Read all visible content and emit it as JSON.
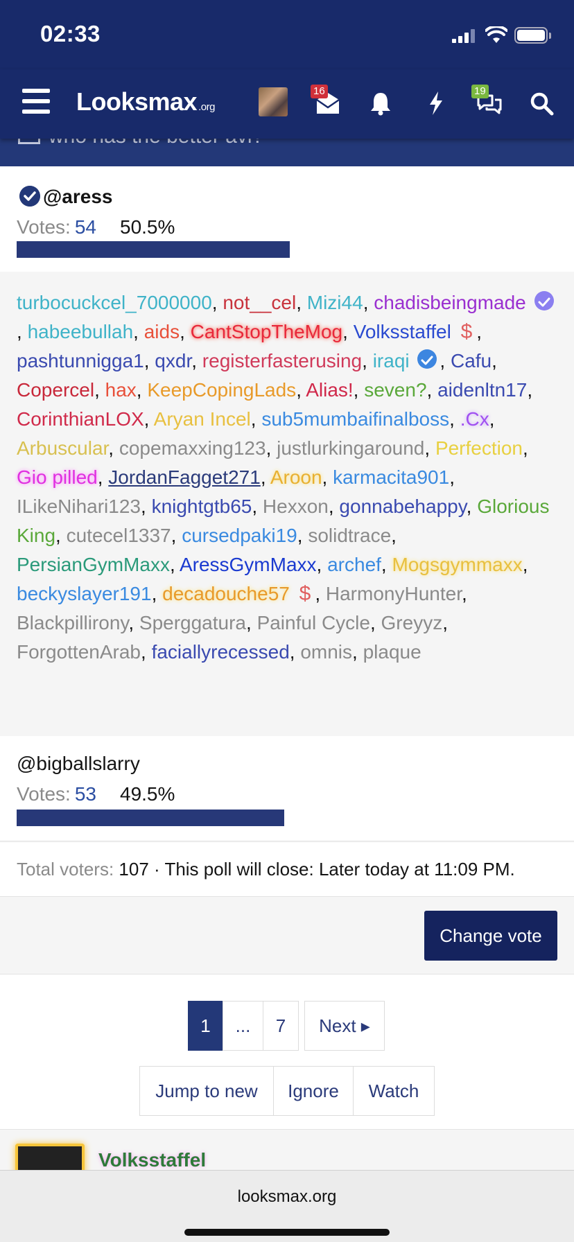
{
  "status_bar": {
    "time": "02:33"
  },
  "navbar": {
    "logo_main": "Looksmax",
    "logo_suffix": ".org",
    "conversations_badge": "16",
    "chat_badge": "19"
  },
  "poll": {
    "question": "who has the better avi?",
    "choices": [
      {
        "label": "@aress",
        "votes_label": "Votes:",
        "votes": "54",
        "percent": "50.5%",
        "bar_fraction": 0.505
      },
      {
        "label": "@bigballslarry",
        "votes_label": "Votes:",
        "votes": "53",
        "percent": "49.5%",
        "bar_fraction": 0.495
      }
    ],
    "voters": [
      {
        "name": "turbocuckcel_7000000",
        "color": "#3fb3c8"
      },
      {
        "name": "not__cel",
        "color": "#c8323c"
      },
      {
        "name": "Mizi44",
        "color": "#3fb3c8"
      },
      {
        "name": "chadisbeingmade",
        "color": "#9a2fd0",
        "badge": "verified-purple"
      },
      {
        "name": "habeebullah",
        "color": "#3fb3c8"
      },
      {
        "name": "aids",
        "color": "#e8503a"
      },
      {
        "name": "CantStopTheMog",
        "color": "#e8283a",
        "glow": "#ff4a30"
      },
      {
        "name": "Volksstaffel",
        "color": "#2a4ad0",
        "badge": "dollar"
      },
      {
        "name": "pashtunnigga1",
        "color": "#3a4ab0"
      },
      {
        "name": "qxdr",
        "color": "#3a4ab0"
      },
      {
        "name": "registerfasterusing",
        "color": "#d03a5a"
      },
      {
        "name": "iraqi",
        "color": "#3fb3c8",
        "badge": "verified-blue"
      },
      {
        "name": "Cafu",
        "color": "#3a4ab0"
      },
      {
        "name": "Copercel",
        "color": "#c8283a"
      },
      {
        "name": "hax",
        "color": "#e8503a"
      },
      {
        "name": "KeepCopingLads",
        "color": "#e89a2a"
      },
      {
        "name": "Alias!",
        "color": "#d0284a"
      },
      {
        "name": "seven?",
        "color": "#5aa83a"
      },
      {
        "name": "aidenltn17",
        "color": "#3a4ab0"
      },
      {
        "name": "CorinthianLOX",
        "color": "#d02a4a"
      },
      {
        "name": "Aryan Incel",
        "color": "#e8c040"
      },
      {
        "name": "sub5mumbaifinalboss",
        "color": "#3a8ae0"
      },
      {
        "name": ".Cx",
        "color": "#a050f0",
        "glow": "#c8a0ff"
      },
      {
        "name": "Arbuscular",
        "color": "#d8c050"
      },
      {
        "name": "copemaxxing123",
        "color": "#8a8a8a"
      },
      {
        "name": "justlurkingaround",
        "color": "#8a8a8a"
      },
      {
        "name": "Perfection",
        "color": "#e8d040"
      },
      {
        "name": "Gio pilled",
        "color": "#e030e0",
        "glow": "#ff80ff"
      },
      {
        "name": "JordanFagget271",
        "color": "#2a3a7a",
        "underline": true
      },
      {
        "name": "Aroon",
        "color": "#e8b030",
        "glow": "#ffe070"
      },
      {
        "name": "karmacita901",
        "color": "#3a8ae0"
      },
      {
        "name": "ILikeNihari123",
        "color": "#8a8a8a"
      },
      {
        "name": "knightgtb65",
        "color": "#3a4ab0"
      },
      {
        "name": "Hexxon",
        "color": "#8a8a8a"
      },
      {
        "name": "gonnabehappy",
        "color": "#3a4ab0"
      },
      {
        "name": "Glorious King",
        "color": "#5aa83a"
      },
      {
        "name": "cutecel1337",
        "color": "#8a8a8a"
      },
      {
        "name": "cursedpaki19",
        "color": "#3a8ae0"
      },
      {
        "name": "solidtrace",
        "color": "#8a8a8a"
      },
      {
        "name": "PersianGymMaxx",
        "color": "#2a9a7a"
      },
      {
        "name": "AressGymMaxx",
        "color": "#1a3ad0"
      },
      {
        "name": "archef",
        "color": "#3a8ae0"
      },
      {
        "name": "Mogsgymmaxx",
        "color": "#e8c040",
        "glow": "#ffe070"
      },
      {
        "name": "beckyslayer191",
        "color": "#3a8ae0"
      },
      {
        "name": "decadouche57",
        "color": "#e89a2a",
        "glow": "#ffe070",
        "badge": "dollar"
      },
      {
        "name": "HarmonyHunter",
        "color": "#8a8a8a"
      },
      {
        "name": "Blackpillirony",
        "color": "#8a8a8a"
      },
      {
        "name": "Sperggatura",
        "color": "#8a8a8a"
      },
      {
        "name": "Painful Cycle",
        "color": "#8a8a8a"
      },
      {
        "name": "Greyyz",
        "color": "#8a8a8a"
      },
      {
        "name": "ForgottenArab",
        "color": "#8a8a8a"
      },
      {
        "name": "faciallyrecessed",
        "color": "#3a4ab0"
      },
      {
        "name": "omnis",
        "color": "#8a8a8a"
      },
      {
        "name": "plaque",
        "color": "#8a8a8a"
      }
    ],
    "total_label": "Total voters:",
    "total_value": "107",
    "close_text": "· This poll will close: Later today at 11:09 PM.",
    "change_vote": "Change vote"
  },
  "pagination": {
    "current": "1",
    "ellipsis": "...",
    "last": "7",
    "next": "Next ▸"
  },
  "thread_actions": {
    "jump": "Jump to new",
    "ignore": "Ignore",
    "watch": "Watch"
  },
  "post": {
    "username": "Volksstaffel"
  },
  "browser": {
    "url": "looksmax.org"
  }
}
